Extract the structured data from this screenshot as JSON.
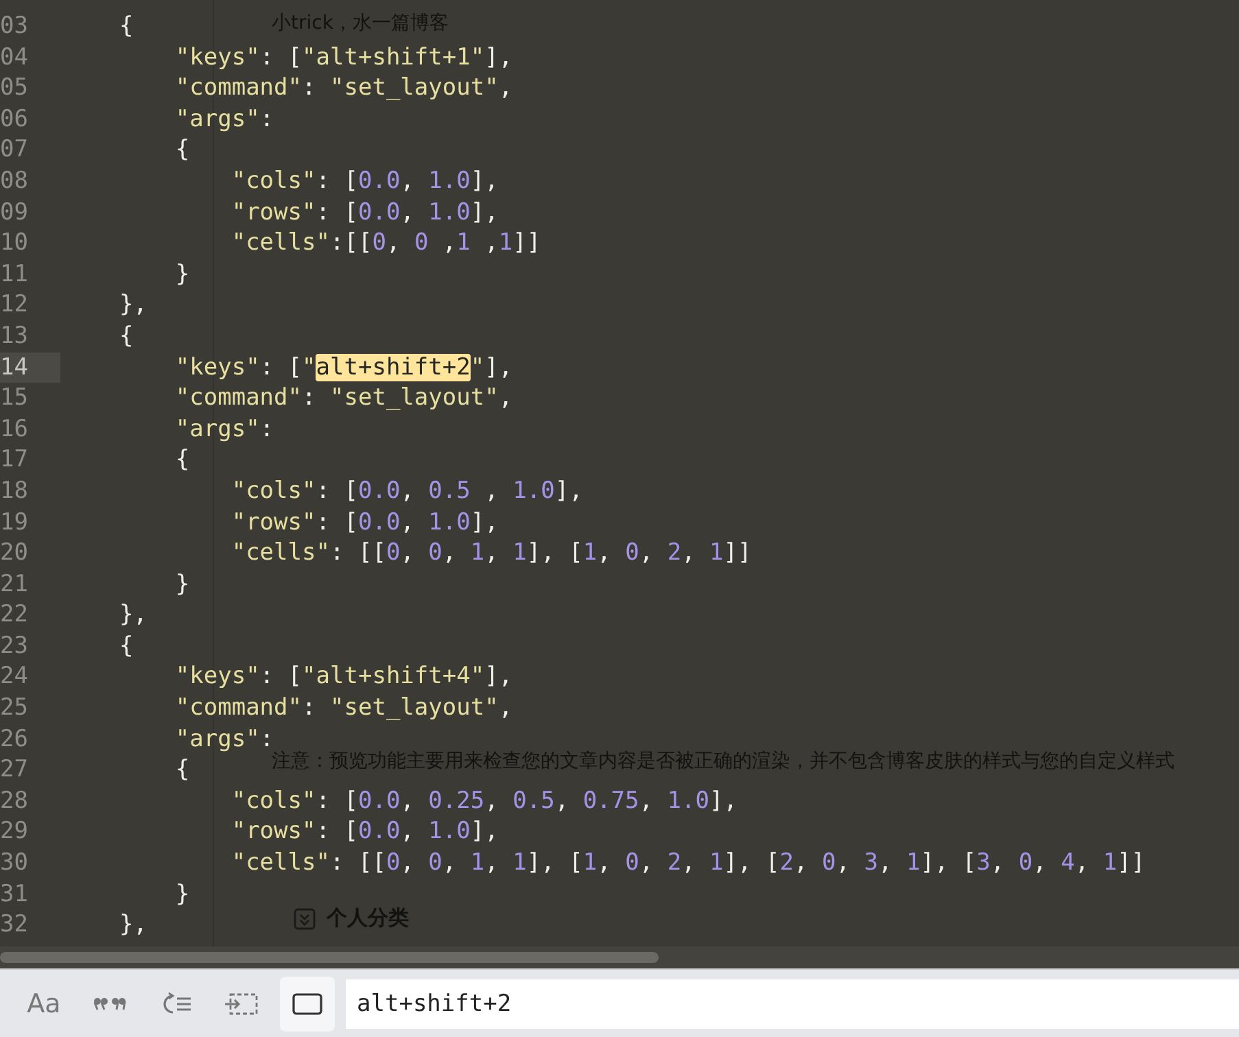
{
  "background_page": {
    "texts": [
      "小trick，水一篇博客",
      "注意：预览功能主要用来检查您的文章内容是否被正确的渲染，并不包含博客皮肤的样式与您的自定义样式",
      "个人分类"
    ]
  },
  "editor": {
    "lines": [
      {
        "number": "03",
        "current": false,
        "parts": [
          {
            "text": "    {",
            "match": false
          }
        ]
      },
      {
        "number": "04",
        "current": false,
        "parts": [
          {
            "text": "        \"keys\": [\"alt+shift+1\"],",
            "match": false
          }
        ]
      },
      {
        "number": "05",
        "current": false,
        "parts": [
          {
            "text": "        \"command\": \"set_layout\",",
            "match": false
          }
        ]
      },
      {
        "number": "06",
        "current": false,
        "parts": [
          {
            "text": "        \"args\":",
            "match": false
          }
        ]
      },
      {
        "number": "07",
        "current": false,
        "parts": [
          {
            "text": "        {",
            "match": false
          }
        ]
      },
      {
        "number": "08",
        "current": false,
        "parts": [
          {
            "text": "            \"cols\": [0.0, 1.0],",
            "match": false
          }
        ]
      },
      {
        "number": "09",
        "current": false,
        "parts": [
          {
            "text": "            \"rows\": [0.0, 1.0],",
            "match": false
          }
        ]
      },
      {
        "number": "10",
        "current": false,
        "parts": [
          {
            "text": "            \"cells\":[[0, 0 ,1 ,1]]",
            "match": false
          }
        ]
      },
      {
        "number": "11",
        "current": false,
        "parts": [
          {
            "text": "        }",
            "match": false
          }
        ]
      },
      {
        "number": "12",
        "current": false,
        "parts": [
          {
            "text": "    },",
            "match": false
          }
        ]
      },
      {
        "number": "13",
        "current": false,
        "parts": [
          {
            "text": "    {",
            "match": false
          }
        ]
      },
      {
        "number": "14",
        "current": true,
        "parts": [
          {
            "text": "        \"keys\": [\"",
            "match": false
          },
          {
            "text": "alt+shift+2",
            "match": true
          },
          {
            "text": "\"],",
            "match": false
          }
        ]
      },
      {
        "number": "15",
        "current": false,
        "parts": [
          {
            "text": "        \"command\": \"set_layout\",",
            "match": false
          }
        ]
      },
      {
        "number": "16",
        "current": false,
        "parts": [
          {
            "text": "        \"args\":",
            "match": false
          }
        ]
      },
      {
        "number": "17",
        "current": false,
        "parts": [
          {
            "text": "        {",
            "match": false
          }
        ]
      },
      {
        "number": "18",
        "current": false,
        "parts": [
          {
            "text": "            \"cols\": [0.0, 0.5 , 1.0],",
            "match": false
          }
        ]
      },
      {
        "number": "19",
        "current": false,
        "parts": [
          {
            "text": "            \"rows\": [0.0, 1.0],",
            "match": false
          }
        ]
      },
      {
        "number": "20",
        "current": false,
        "parts": [
          {
            "text": "            \"cells\": [[0, 0, 1, 1], [1, 0, 2, 1]]",
            "match": false
          }
        ]
      },
      {
        "number": "21",
        "current": false,
        "parts": [
          {
            "text": "        }",
            "match": false
          }
        ]
      },
      {
        "number": "22",
        "current": false,
        "parts": [
          {
            "text": "    },",
            "match": false
          }
        ]
      },
      {
        "number": "23",
        "current": false,
        "parts": [
          {
            "text": "    {",
            "match": false
          }
        ]
      },
      {
        "number": "24",
        "current": false,
        "parts": [
          {
            "text": "        \"keys\": [\"alt+shift+4\"],",
            "match": false
          }
        ]
      },
      {
        "number": "25",
        "current": false,
        "parts": [
          {
            "text": "        \"command\": \"set_layout\",",
            "match": false
          }
        ]
      },
      {
        "number": "26",
        "current": false,
        "parts": [
          {
            "text": "        \"args\":",
            "match": false
          }
        ]
      },
      {
        "number": "27",
        "current": false,
        "parts": [
          {
            "text": "        {",
            "match": false
          }
        ]
      },
      {
        "number": "28",
        "current": false,
        "parts": [
          {
            "text": "            \"cols\": [0.0, 0.25, 0.5, 0.75, 1.0],",
            "match": false
          }
        ]
      },
      {
        "number": "29",
        "current": false,
        "parts": [
          {
            "text": "            \"rows\": [0.0, 1.0],",
            "match": false
          }
        ]
      },
      {
        "number": "30",
        "current": false,
        "parts": [
          {
            "text": "            \"cells\": [[0, 0, 1, 1], [1, 0, 2, 1], [2, 0, 3, 1], [3, 0, 4, 1]]",
            "match": false
          }
        ]
      },
      {
        "number": "31",
        "current": false,
        "parts": [
          {
            "text": "        }",
            "match": false
          }
        ]
      },
      {
        "number": "32",
        "current": false,
        "parts": [
          {
            "text": "    },",
            "match": false
          }
        ]
      }
    ]
  },
  "find_bar": {
    "options": [
      {
        "kind": "case",
        "label": "Aa",
        "selected": false
      },
      {
        "kind": "whole_word",
        "selected": false
      },
      {
        "kind": "wrap",
        "selected": false
      },
      {
        "kind": "in_selection",
        "selected": false
      },
      {
        "kind": "highlight",
        "selected": true
      }
    ],
    "value": "alt+shift+2"
  }
}
